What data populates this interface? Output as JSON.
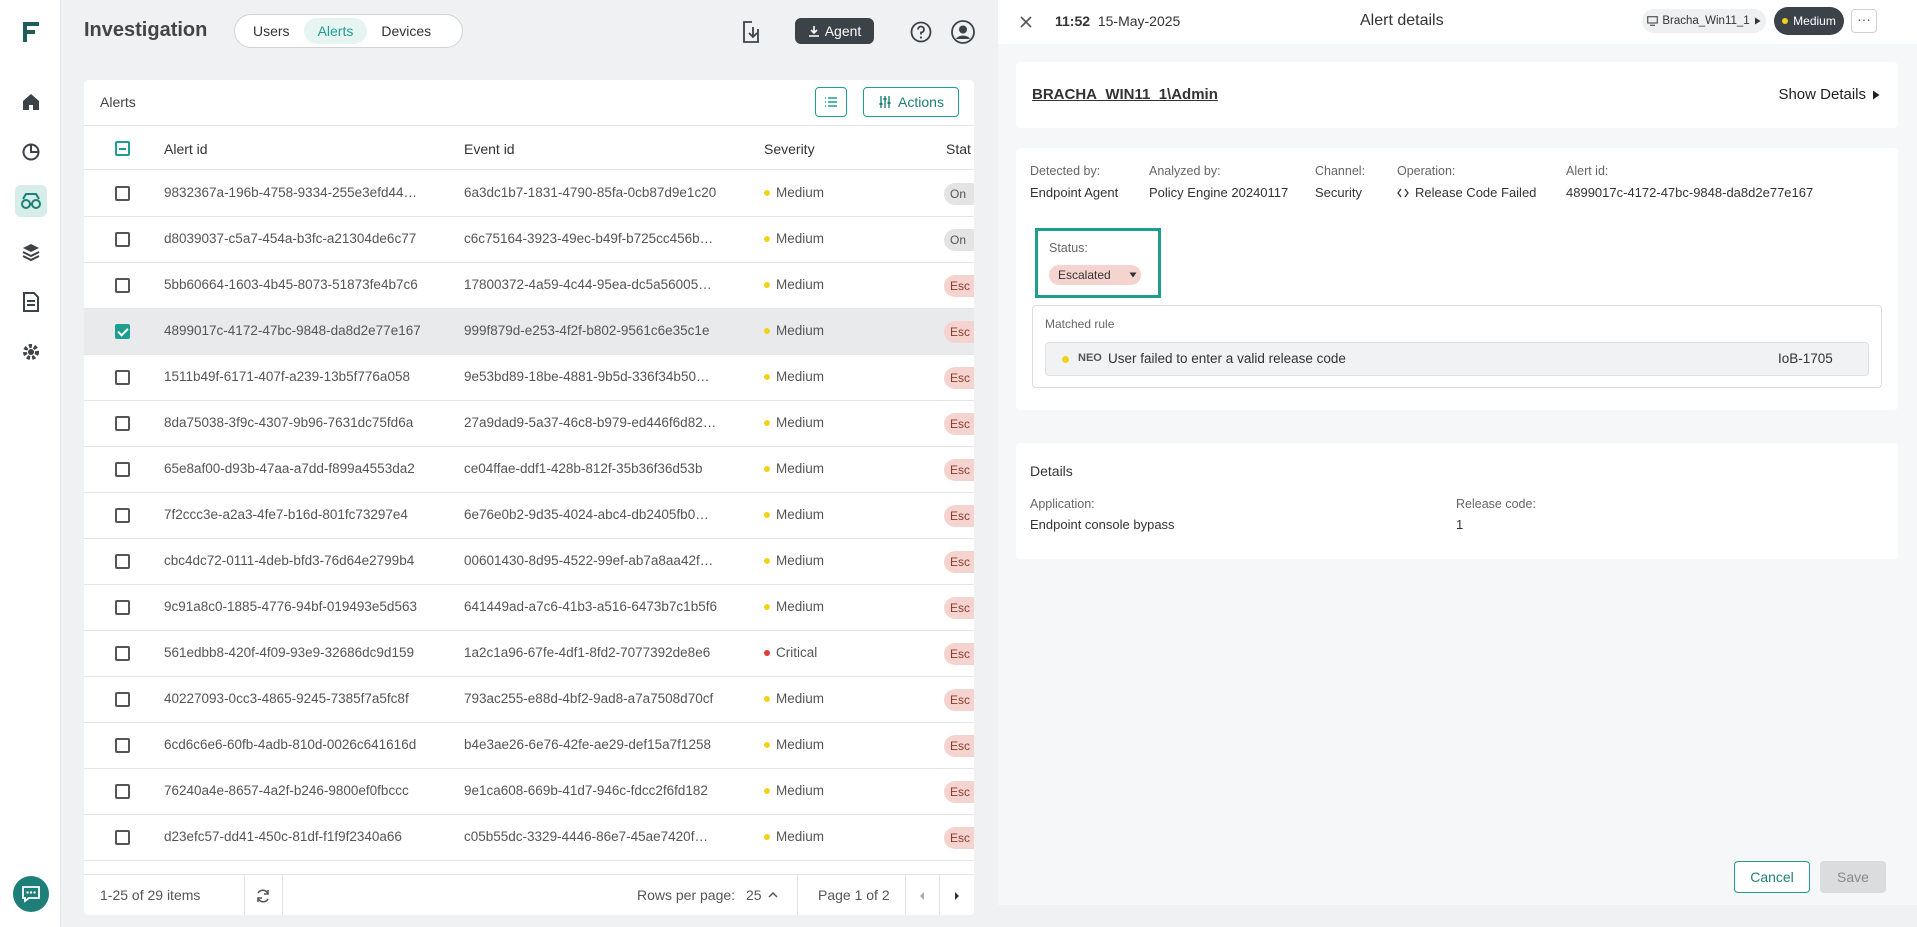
{
  "header": {
    "title": "Investigation",
    "tabs": [
      {
        "label": "Users"
      },
      {
        "label": "Alerts"
      },
      {
        "label": "Devices"
      }
    ],
    "agent_label": "Agent"
  },
  "alerts": {
    "title": "Alerts",
    "actions_label": "Actions",
    "columns": {
      "alert_id": "Alert id",
      "event_id": "Event id",
      "severity": "Severity",
      "status": "Stat"
    },
    "rows": [
      {
        "alert_id": "9832367a-196b-4758-9334-255e3efd44…",
        "event_id": "6a3dc1b7-1831-4790-85fa-0cb87d9e1c20",
        "severity": "Medium",
        "status": "On",
        "checked": false
      },
      {
        "alert_id": "d8039037-c5a7-454a-b3fc-a21304de6c77",
        "event_id": "c6c75164-3923-49ec-b49f-b725cc456b…",
        "severity": "Medium",
        "status": "On",
        "checked": false
      },
      {
        "alert_id": "5bb60664-1603-4b45-8073-51873fe4b7c6",
        "event_id": "17800372-4a59-4c44-95ea-dc5a56005…",
        "severity": "Medium",
        "status": "Esc",
        "checked": false
      },
      {
        "alert_id": "4899017c-4172-47bc-9848-da8d2e77e167",
        "event_id": "999f879d-e253-4f2f-b802-9561c6e35c1e",
        "severity": "Medium",
        "status": "Esc",
        "checked": true
      },
      {
        "alert_id": "1511b49f-6171-407f-a239-13b5f776a058",
        "event_id": "9e53bd89-18be-4881-9b5d-336f34b50…",
        "severity": "Medium",
        "status": "Esc",
        "checked": false
      },
      {
        "alert_id": "8da75038-3f9c-4307-9b96-7631dc75fd6a",
        "event_id": "27a9dad9-5a37-46c8-b979-ed446f6d82…",
        "severity": "Medium",
        "status": "Esc",
        "checked": false
      },
      {
        "alert_id": "65e8af00-d93b-47aa-a7dd-f899a4553da2",
        "event_id": "ce04ffae-ddf1-428b-812f-35b36f36d53b",
        "severity": "Medium",
        "status": "Esc",
        "checked": false
      },
      {
        "alert_id": "7f2ccc3e-a2a3-4fe7-b16d-801fc73297e4",
        "event_id": "6e76e0b2-9d35-4024-abc4-db2405fb0…",
        "severity": "Medium",
        "status": "Esc",
        "checked": false
      },
      {
        "alert_id": "cbc4dc72-0111-4deb-bfd3-76d64e2799b4",
        "event_id": "00601430-8d95-4522-99ef-ab7a8aa42f…",
        "severity": "Medium",
        "status": "Esc",
        "checked": false
      },
      {
        "alert_id": "9c91a8c0-1885-4776-94bf-019493e5d563",
        "event_id": "641449ad-a7c6-41b3-a516-6473b7c1b5f6",
        "severity": "Medium",
        "status": "Esc",
        "checked": false
      },
      {
        "alert_id": "561edbb8-420f-4f09-93e9-32686dc9d159",
        "event_id": "1a2c1a96-67fe-4df1-8fd2-7077392de8e6",
        "severity": "Critical",
        "status": "Esc",
        "checked": false
      },
      {
        "alert_id": "40227093-0cc3-4865-9245-7385f7a5fc8f",
        "event_id": "793ac255-e88d-4bf2-9ad8-a7a7508d70cf",
        "severity": "Medium",
        "status": "Esc",
        "checked": false
      },
      {
        "alert_id": "6cd6c6e6-60fb-4adb-810d-0026c641616d",
        "event_id": "b4e3ae26-6e76-42fe-ae29-def15a7f1258",
        "severity": "Medium",
        "status": "Esc",
        "checked": false
      },
      {
        "alert_id": "76240a4e-8657-4a2f-b246-9800ef0fbccc",
        "event_id": "9e1ca608-669b-41d7-946c-fdcc2f6fd182",
        "severity": "Medium",
        "status": "Esc",
        "checked": false
      },
      {
        "alert_id": "d23efc57-dd41-450c-81df-f1f9f2340a66",
        "event_id": "c05b55dc-3329-4446-86e7-45ae7420f…",
        "severity": "Medium",
        "status": "Esc",
        "checked": false
      }
    ],
    "footer": {
      "items": "1-25 of 29 items",
      "rows_per_page_label": "Rows per page:",
      "rows_per_page": "25",
      "page": "Page 1 of 2"
    }
  },
  "colors": {
    "accent": "#1e9e8e",
    "medium": "#f2d21b",
    "critical": "#e53935",
    "escalated_bg": "#f5d4cf"
  },
  "panel": {
    "time": "11:52",
    "date": "15-May-2025",
    "title": "Alert details",
    "host": "Bracha_Win11_1",
    "severity": "Medium",
    "more": "···",
    "user": "BRACHA_WIN11_1\\Admin",
    "show_details": "Show Details",
    "fields": {
      "detected_by_label": "Detected by:",
      "detected_by": "Endpoint Agent",
      "analyzed_by_label": "Analyzed by:",
      "analyzed_by": "Policy Engine 20240117",
      "channel_label": "Channel:",
      "channel": "Security",
      "operation_label": "Operation:",
      "operation": "Release Code Failed",
      "alert_id_label": "Alert id:",
      "alert_id": "4899017c-4172-47bc-9848-da8d2e77e167"
    },
    "status_label": "Status:",
    "status_value": "Escalated",
    "matched_rule_label": "Matched rule",
    "rule": {
      "tag": "NEO",
      "text": "User failed to enter a valid release code",
      "id": "IoB-1705"
    },
    "details": {
      "title": "Details",
      "application_label": "Application:",
      "application": "Endpoint console bypass",
      "release_code_label": "Release code:",
      "release_code": "1"
    },
    "cancel_label": "Cancel",
    "save_label": "Save"
  }
}
